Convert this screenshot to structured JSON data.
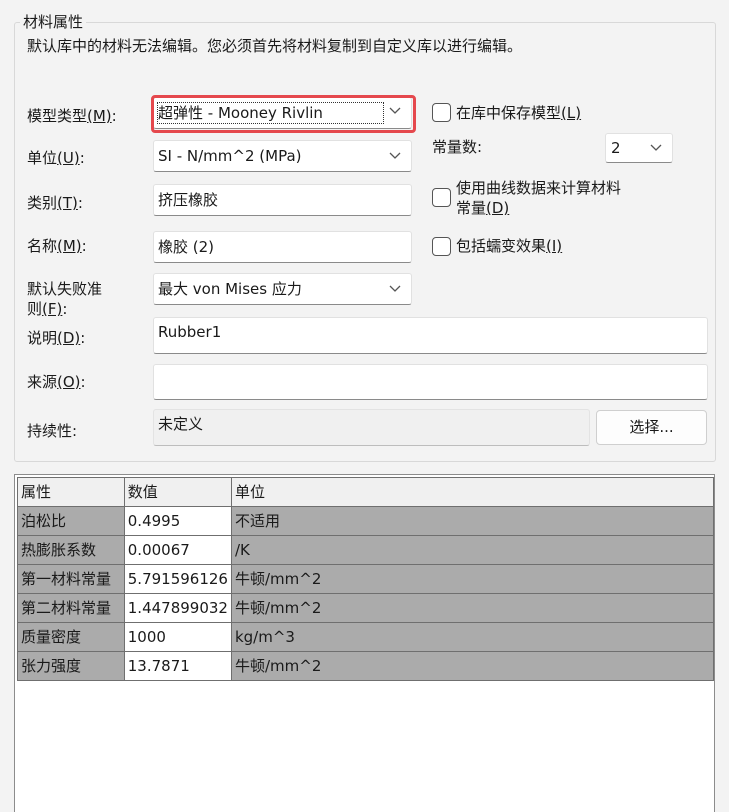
{
  "group_title": "材料属性",
  "notice": "默认库中的材料无法编辑。您必须首先将材料复制到自定义库以进行编辑。",
  "model_type": {
    "label": "模型类型",
    "mnemonic": "(M)",
    "colon": ":",
    "value": "超弹性 - Mooney Rivlin"
  },
  "unit": {
    "label": "单位",
    "mnemonic": "(U)",
    "colon": ":",
    "value": "SI - N/mm^2 (MPa)"
  },
  "category": {
    "label": "类别",
    "mnemonic": "(T)",
    "colon": ":",
    "value": "挤压橡胶"
  },
  "name": {
    "label": "名称",
    "mnemonic": "(M)",
    "colon": ":",
    "value": "橡胶 (2)"
  },
  "failure_criterion": {
    "label_line1": "默认失败准",
    "label_line2": "则",
    "mnemonic": "(F)",
    "colon": ":",
    "value": "最大 von Mises 应力"
  },
  "description": {
    "label": "说明",
    "mnemonic": "(D)",
    "colon": ":",
    "value": "Rubber1"
  },
  "source": {
    "label": "来源",
    "mnemonic": "(O)",
    "colon": ":",
    "value": ""
  },
  "sustainability": {
    "label": "持续性:",
    "value": "未定义",
    "button": "选择..."
  },
  "save_model": {
    "label": "在库中保存模型",
    "mnemonic": "(L)"
  },
  "constants": {
    "label": "常量数:",
    "value": "2"
  },
  "curve_data": {
    "label_line1": "使用曲线数据来计算材料",
    "label_line2": "常量",
    "mnemonic": "(D)"
  },
  "creep": {
    "label": "包括蠕变效果",
    "mnemonic": "(I)"
  },
  "table": {
    "headers": [
      "属性",
      "数值",
      "单位"
    ],
    "rows": [
      [
        "泊松比",
        "0.4995",
        "不适用"
      ],
      [
        "热膨胀系数",
        "0.00067",
        "/K"
      ],
      [
        "第一材料常量",
        "5.791596126",
        "牛顿/mm^2"
      ],
      [
        "第二材料常量",
        "1.447899032",
        "牛顿/mm^2"
      ],
      [
        "质量密度",
        "1000",
        "kg/m^3"
      ],
      [
        "张力强度",
        "13.7871",
        "牛顿/mm^2"
      ]
    ]
  },
  "colors": {
    "highlight": "#e5484d",
    "grid_gray": "#ababab",
    "background": "#f3f3f3"
  },
  "icons": [
    "chevron-down-icon"
  ]
}
